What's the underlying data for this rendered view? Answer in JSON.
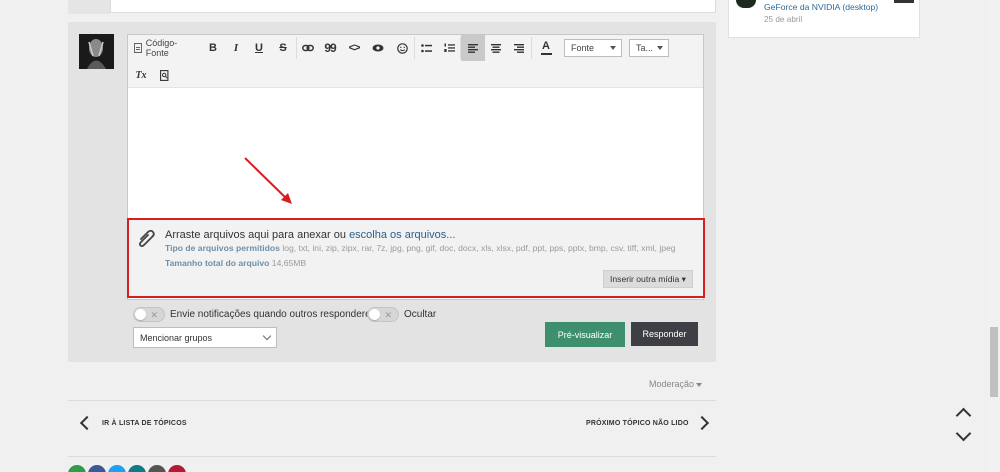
{
  "editor": {
    "toolbar": {
      "source_label": "Código-Fonte",
      "bold": "B",
      "italic": "I",
      "underline": "U",
      "strike": "S",
      "quote": "99",
      "code": "<>",
      "font_select": "Fonte",
      "size_select": "Ta...",
      "text_color": "A",
      "clear_format": "Tx"
    }
  },
  "attachments": {
    "drag_text": "Arraste arquivos aqui para anexar ou ",
    "choose_link": "escolha os arquivos...",
    "types_label": "Tipo de arquivos permitidos",
    "types_value": "log, txt, ini, zip, zipx, rar, 7z, jpg, png, gif, doc, docx, xls, xlsx, pdf, ppt, pps, pptx, bmp, csv, tiff, xml, jpeg ·",
    "size_label": "Tamanho total do arquivo",
    "size_value": "14,65MB",
    "insert_media": "Inserir outra mídia ▾"
  },
  "options": {
    "notify_label": "Envie notificações quando outros responderem",
    "hide_label": "Ocultar",
    "groups_select": "Mencionar grupos"
  },
  "actions": {
    "preview": "Pré-visualizar",
    "reply": "Responder"
  },
  "moderation": "Moderação",
  "nav": {
    "back_to_list": "IR À LISTA DE TÓPICOS",
    "next_unread": "PRÓXIMO TÓPICO NÃO LIDO"
  },
  "sidebar": {
    "title": "GeForce da NVIDIA (desktop)",
    "date": "25 de abril"
  },
  "colors": {
    "accent_red": "#d81e1e",
    "preview_green": "#3e8f6e",
    "reply_dark": "#3d3f45",
    "link_blue": "#2b5f8c"
  },
  "share_colors": [
    "#2e9c4a",
    "#3b5998",
    "#1da1f2",
    "#0e7a8a",
    "#555555",
    "#b31b34"
  ]
}
